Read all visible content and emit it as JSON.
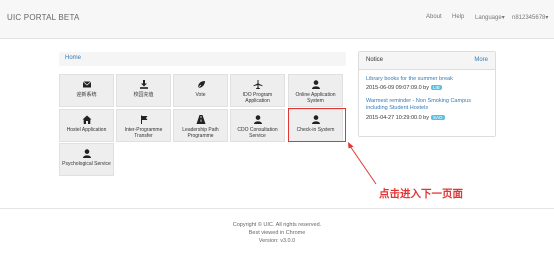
{
  "navbar": {
    "brand": "UIC PORTAL BETA",
    "links": [
      "About",
      "Help",
      "Language▾",
      "n812345678▾"
    ]
  },
  "breadcrumb": {
    "home": "Home"
  },
  "tiles": [
    {
      "label": "迎新系统",
      "icon": "envelope-icon"
    },
    {
      "label": "校园充值",
      "icon": "download-icon"
    },
    {
      "label": "Vote",
      "icon": "leaf-icon"
    },
    {
      "label": "IDO Program Application",
      "icon": "plane-icon"
    },
    {
      "label": "Online Application System",
      "icon": "user-icon"
    },
    {
      "label": "Hostel Application",
      "icon": "home-icon"
    },
    {
      "label": "Inter-Programme Transfer",
      "icon": "flag-icon"
    },
    {
      "label": "Leadership Path Programme",
      "icon": "road-icon"
    },
    {
      "label": "CDO Consultation Service",
      "icon": "user-icon"
    },
    {
      "label": "Check-in System",
      "icon": "user-icon"
    },
    {
      "label": "Psychological Service",
      "icon": "user-icon"
    }
  ],
  "notice": {
    "title": "Notice",
    "more": "More",
    "items": [
      {
        "title": "Library books for the summer break",
        "date": "2015-06-09 09:07:09.0 by",
        "badge": "LIB"
      },
      {
        "title": "Warmest reminder - Non Smoking Campus including Student Hostels",
        "date": "2015-04-27 10:29:00.0 by",
        "badge": "SAO"
      }
    ]
  },
  "annotation": "点击进入下一页面",
  "footer": {
    "copyright": "Copyright © UIC. All rights reserved.",
    "browser": "Best viewed in Chrome",
    "version": "Version: v3.0.0"
  },
  "colors": {
    "link": "#337ab7",
    "annotation": "#e23636",
    "badge": "#5bc0de",
    "tile_bg": "#eeeeee"
  }
}
